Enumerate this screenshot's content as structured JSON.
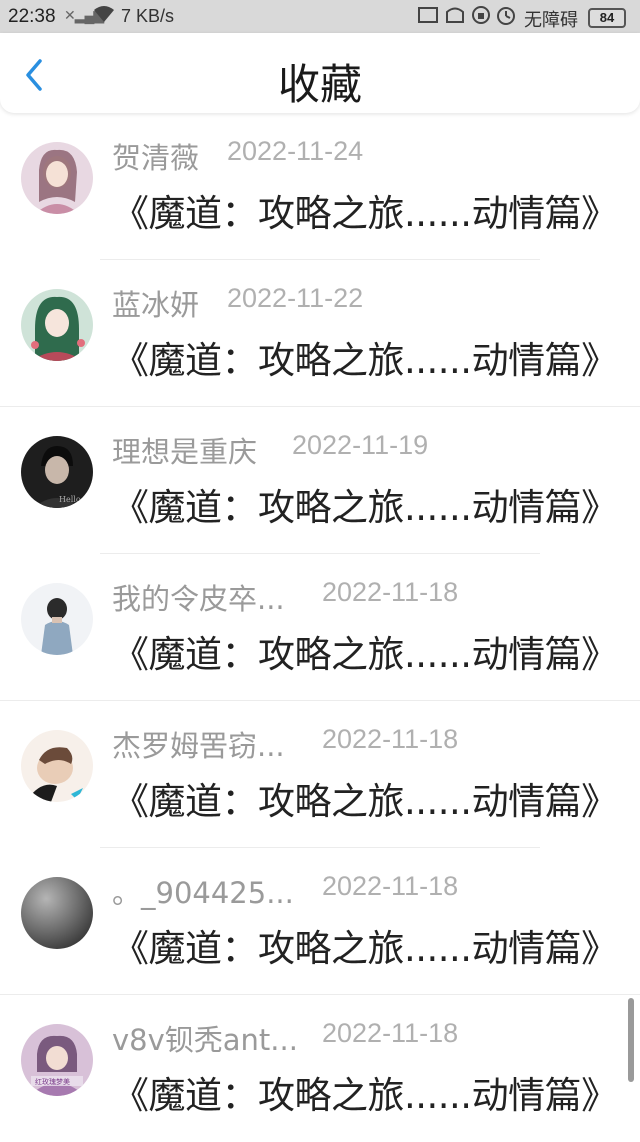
{
  "status_bar": {
    "time": "22:38",
    "speed": "7 KB/s",
    "network": "无障碍",
    "battery": "84"
  },
  "header": {
    "title": "收藏"
  },
  "items": [
    {
      "username": "贺清薇",
      "date": "2022-11-24",
      "title": "《魔道：攻略之旅......动情篇》",
      "avatar_color": "#c9a5b6"
    },
    {
      "username": "蓝冰妍",
      "date": "2022-11-22",
      "title": "《魔道：攻略之旅......动情篇》",
      "avatar_color": "#6fa38a"
    },
    {
      "username": "理想是重庆",
      "date": "2022-11-19",
      "title": "《魔道：攻略之旅......动情篇》",
      "avatar_color": "#2b2b2b"
    },
    {
      "username": "我的令皮卒...",
      "date": "2022-11-18",
      "title": "《魔道：攻略之旅......动情篇》",
      "avatar_color": "#8ea7bd"
    },
    {
      "username": "杰罗姆罟窃...",
      "date": "2022-11-18",
      "title": "《魔道：攻略之旅......动情篇》",
      "avatar_color": "#caa88f"
    },
    {
      "username": "。_904425...",
      "date": "2022-11-18",
      "title": "《魔道：攻略之旅......动情篇》",
      "avatar_color": "#6a6a6a"
    },
    {
      "username": "v8v钡秃ant...",
      "date": "2022-11-18",
      "title": "《魔道：攻略之旅......动情篇》",
      "avatar_color": "#b695b5"
    }
  ]
}
